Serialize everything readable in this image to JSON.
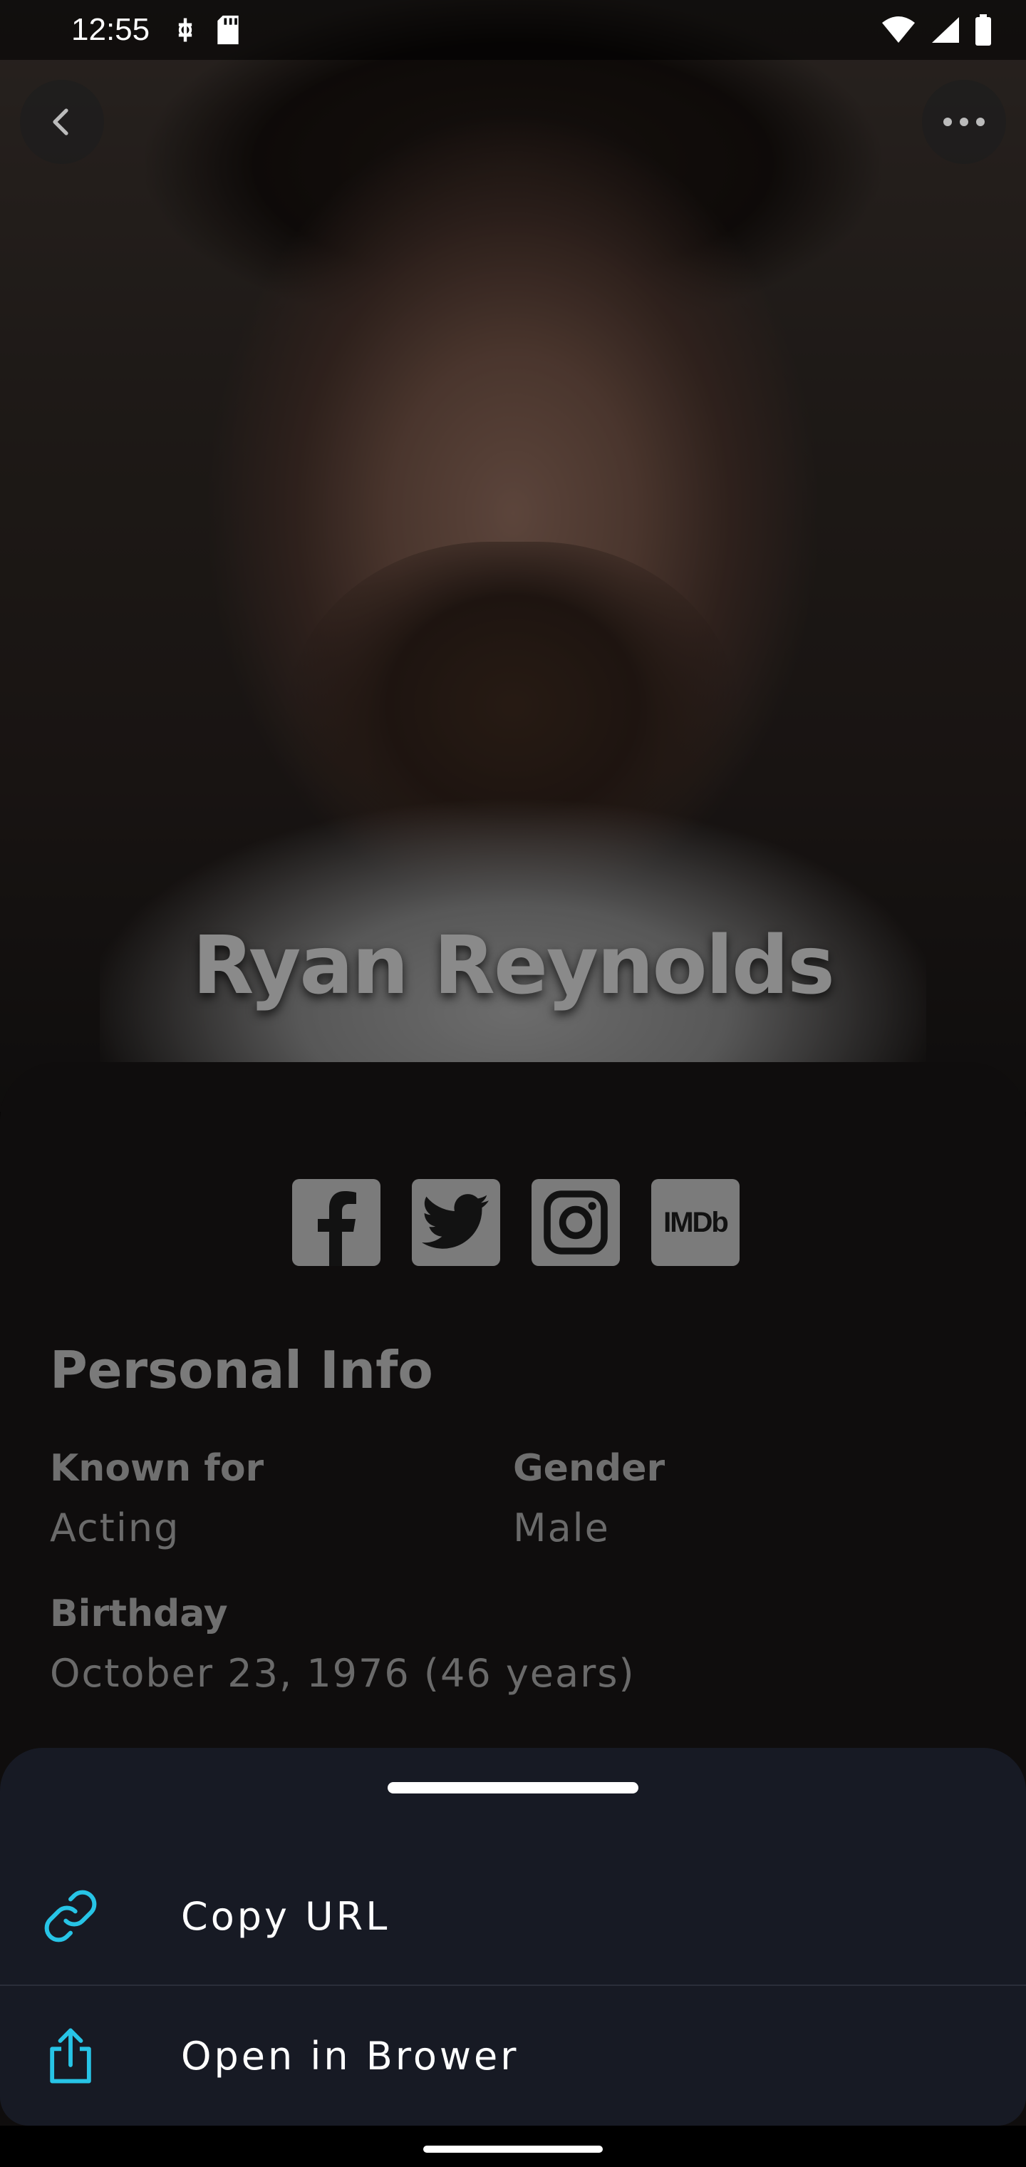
{
  "status_bar": {
    "time": "12:55"
  },
  "person": {
    "name": "Ryan Reynolds"
  },
  "social_links": [
    {
      "name": "facebook",
      "icon": "facebook-icon"
    },
    {
      "name": "twitter",
      "icon": "twitter-icon"
    },
    {
      "name": "instagram",
      "icon": "instagram-icon"
    },
    {
      "name": "imdb",
      "icon": "imdb-icon",
      "text": "IMDb"
    }
  ],
  "personal_info": {
    "title": "Personal Info",
    "known_for_label": "Known for",
    "known_for_value": "Acting",
    "gender_label": "Gender",
    "gender_value": "Male",
    "birthday_label": "Birthday",
    "birthday_value": "October 23, 1976 (46 years)"
  },
  "share_sheet": {
    "copy_url_label": "Copy URL",
    "open_browser_label": "Open in Brower"
  },
  "colors": {
    "sheet_bg": "#171a24",
    "accent_cyan": "#27c4e6"
  }
}
